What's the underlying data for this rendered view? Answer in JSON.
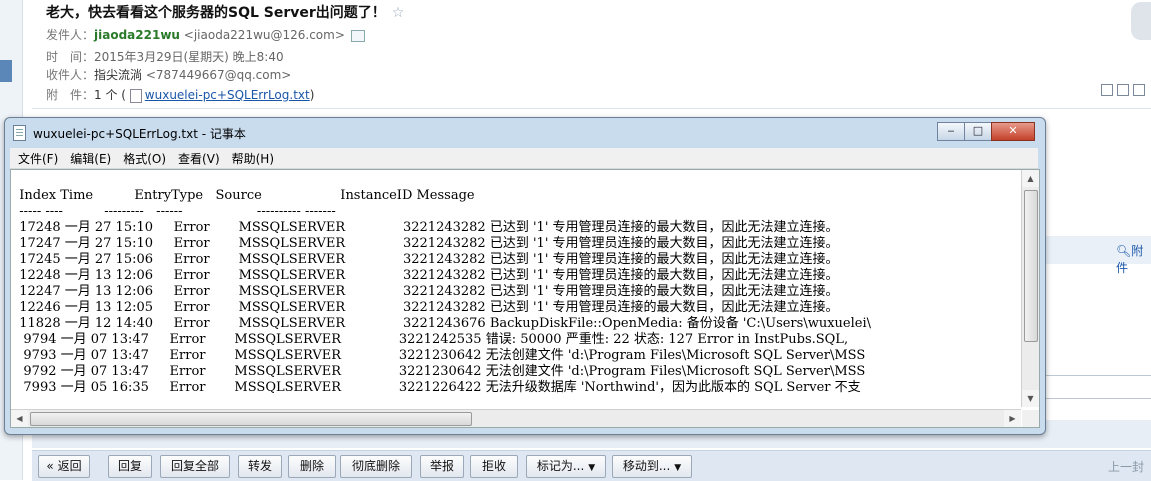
{
  "mail": {
    "subject": "老大，快去看看这个服务器的SQL Server出问题了！",
    "star": "☆",
    "from_label": "发件人：",
    "from_name": "jiaoda221wu",
    "from_email": "<jiaoda221wu@126.com>",
    "time_label": "时　间：",
    "time_value": "2015年3月29日(星期天) 晚上8:40",
    "to_label": "收件人：",
    "to_name": "指尖流淌",
    "to_email": "<787449667@qq.com>",
    "attach_label": "附　件：",
    "attach_count": "1 个 (",
    "attach_file": "wuxuelei-pc+SQLErrLog.txt",
    "attach_close": ")",
    "side_attach": "附件"
  },
  "notepad": {
    "title": "wuxuelei-pc+SQLErrLog.txt - 记事本",
    "menu": [
      "文件(F)",
      "编辑(E)",
      "格式(O)",
      "查看(V)",
      "帮助(H)"
    ],
    "columns": [
      "Index",
      "Time",
      "EntryType",
      "Source",
      "InstanceID",
      "Message"
    ],
    "rows": [
      {
        "index": "17248",
        "time": "一月 27 15:10",
        "type": "Error",
        "source": "MSSQLSERVER",
        "instance": "3221243282",
        "message": "已达到 '1' 专用管理员连接的最大数目，因此无法建立连接。"
      },
      {
        "index": "17247",
        "time": "一月 27 15:10",
        "type": "Error",
        "source": "MSSQLSERVER",
        "instance": "3221243282",
        "message": "已达到 '1' 专用管理员连接的最大数目，因此无法建立连接。"
      },
      {
        "index": "17245",
        "time": "一月 27 15:06",
        "type": "Error",
        "source": "MSSQLSERVER",
        "instance": "3221243282",
        "message": "已达到 '1' 专用管理员连接的最大数目，因此无法建立连接。"
      },
      {
        "index": "12248",
        "time": "一月 13 12:06",
        "type": "Error",
        "source": "MSSQLSERVER",
        "instance": "3221243282",
        "message": "已达到 '1' 专用管理员连接的最大数目，因此无法建立连接。"
      },
      {
        "index": "12247",
        "time": "一月 13 12:06",
        "type": "Error",
        "source": "MSSQLSERVER",
        "instance": "3221243282",
        "message": "已达到 '1' 专用管理员连接的最大数目，因此无法建立连接。"
      },
      {
        "index": "12246",
        "time": "一月 13 12:05",
        "type": "Error",
        "source": "MSSQLSERVER",
        "instance": "3221243282",
        "message": "已达到 '1' 专用管理员连接的最大数目，因此无法建立连接。"
      },
      {
        "index": "11828",
        "time": "一月 12 14:40",
        "type": "Error",
        "source": "MSSQLSERVER",
        "instance": "3221243676",
        "message": "BackupDiskFile::OpenMedia: 备份设备 'C:\\Users\\wuxuelei\\"
      },
      {
        "index": "9794",
        "time": "一月 07 13:47",
        "type": "Error",
        "source": "MSSQLSERVER",
        "instance": "3221242535",
        "message": "错误: 50000 严重性: 22 状态: 127 Error in InstPubs.SQL,"
      },
      {
        "index": "9793",
        "time": "一月 07 13:47",
        "type": "Error",
        "source": "MSSQLSERVER",
        "instance": "3221230642",
        "message": "无法创建文件 'd:\\Program Files\\Microsoft SQL Server\\MSS"
      },
      {
        "index": "9792",
        "time": "一月 07 13:47",
        "type": "Error",
        "source": "MSSQLSERVER",
        "instance": "3221230642",
        "message": "无法创建文件 'd:\\Program Files\\Microsoft SQL Server\\MSS"
      },
      {
        "index": "7993",
        "time": "一月 05 16:35",
        "type": "Error",
        "source": "MSSQLSERVER",
        "instance": "3221226422",
        "message": "无法升级数据库 'Northwind'，因为此版本的 SQL Server 不支"
      }
    ],
    "scroll_h_grip": "III",
    "scroll_v_grip": "≡"
  },
  "actions": {
    "back": "« 返回",
    "buttons": [
      "回复",
      "回复全部",
      "转发",
      "删除",
      "彻底删除",
      "举报",
      "拒收"
    ],
    "mark": "标记为...",
    "move": "移动到...",
    "prev": "上一封"
  }
}
